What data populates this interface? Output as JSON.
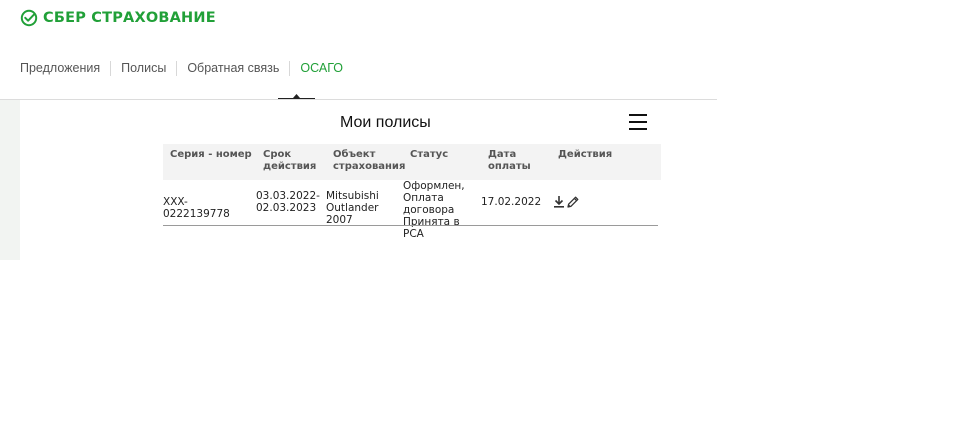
{
  "brand": {
    "name": "СБЕР СТРАХОВАНИЕ",
    "color": "#21a038",
    "icon": "sber-check-icon"
  },
  "nav": {
    "items": [
      {
        "label": "Предложения"
      },
      {
        "label": "Полисы"
      },
      {
        "label": "Обратная связь"
      },
      {
        "label": "ОСАГО",
        "active": true
      }
    ]
  },
  "main": {
    "title": "Мои полисы",
    "menu_icon": "hamburger-icon",
    "table": {
      "headers": {
        "number": "Серия - номер",
        "term": "Срок действия",
        "object": "Объект страхования",
        "status": "Статус",
        "payment_date": "Дата оплаты",
        "actions": "Действия"
      },
      "rows": [
        {
          "number": "XXX- 0222139778",
          "term": "03.03.2022-02.03.2023",
          "object": "Mitsubishi Outlander 2007",
          "status": "Оформлен, Оплата договора Принята в РСА",
          "payment_date": "17.02.2022",
          "actions": [
            "download-icon",
            "edit-pencil-icon"
          ]
        }
      ]
    }
  }
}
